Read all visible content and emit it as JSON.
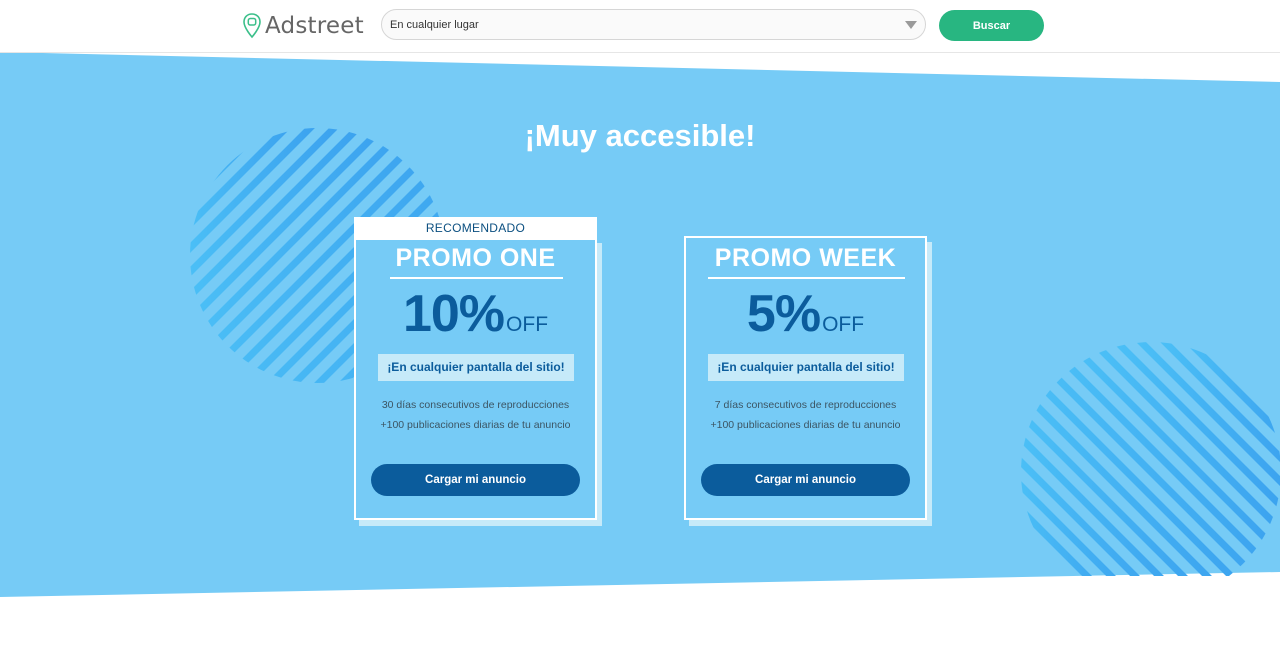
{
  "header": {
    "logo_text": "Adstreet",
    "search_placeholder": "En cualquier lugar",
    "search_button": "Buscar"
  },
  "hero": {
    "title": "¡Muy accesible!"
  },
  "plans": [
    {
      "badge": "RECOMENDADO",
      "name": "PROMO ONE",
      "discount": "10%",
      "off": "OFF",
      "highlight": "¡En cualquier pantalla del sitio!",
      "features": [
        "30 días consecutivos de reproducciones",
        "+100 publicaciones diarias de tu anuncio"
      ],
      "cta": "Cargar mi anuncio"
    },
    {
      "name": "PROMO WEEK",
      "discount": "5%",
      "off": "OFF",
      "highlight": "¡En cualquier pantalla del sitio!",
      "features": [
        "7 días consecutivos de reproducciones",
        "+100 publicaciones diarias de tu anuncio"
      ],
      "cta": "Cargar mi anuncio"
    }
  ],
  "colors": {
    "brand_green": "#28b681",
    "band_blue": "#76cbf6",
    "dark_blue": "#0b5c9c",
    "light_blue": "#c6eaf9"
  },
  "icons": [
    "map-pin-icon",
    "dropdown-arrow-icon"
  ]
}
